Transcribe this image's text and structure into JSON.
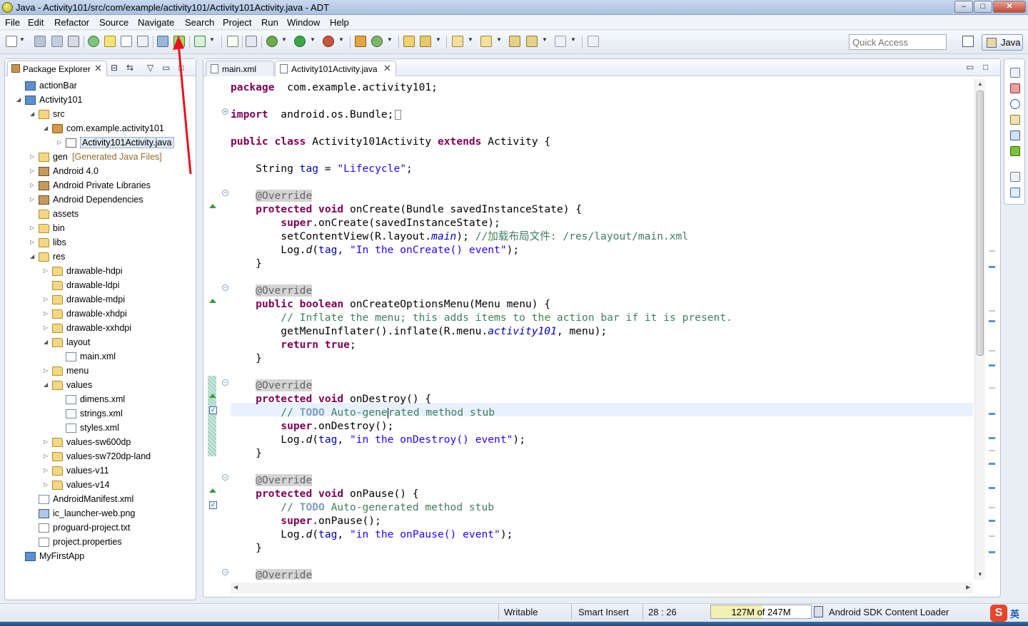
{
  "window": {
    "title": "Java - Activity101/src/com/example/activity101/Activity101Activity.java - ADT",
    "minimize": "–",
    "maximize": "□",
    "close": "✕"
  },
  "menu": [
    "File",
    "Edit",
    "Refactor",
    "Source",
    "Navigate",
    "Search",
    "Project",
    "Run",
    "Window",
    "Help"
  ],
  "toolbar": {
    "quick_access_placeholder": "Quick Access",
    "perspective_label": "Java"
  },
  "package_explorer": {
    "tab_label": "Package Explorer",
    "tree": [
      {
        "label": "actionBar",
        "depth": 0,
        "arrow": "",
        "icon": "project"
      },
      {
        "label": "Activity101",
        "depth": 0,
        "arrow": "open",
        "icon": "project"
      },
      {
        "label": "src",
        "depth": 1,
        "arrow": "open",
        "icon": "src"
      },
      {
        "label": "com.example.activity101",
        "depth": 2,
        "arrow": "open",
        "icon": "package"
      },
      {
        "label": "Activity101Activity.java",
        "depth": 3,
        "arrow": "closed",
        "icon": "java",
        "selected": true
      },
      {
        "label": "gen",
        "suffix": "[Generated Java Files]",
        "depth": 1,
        "arrow": "closed",
        "icon": "src"
      },
      {
        "label": "Android 4.0",
        "depth": 1,
        "arrow": "closed",
        "icon": "lib"
      },
      {
        "label": "Android Private Libraries",
        "depth": 1,
        "arrow": "closed",
        "icon": "lib"
      },
      {
        "label": "Android Dependencies",
        "depth": 1,
        "arrow": "closed",
        "icon": "lib"
      },
      {
        "label": "assets",
        "depth": 1,
        "arrow": "",
        "icon": "folder"
      },
      {
        "label": "bin",
        "depth": 1,
        "arrow": "closed",
        "icon": "folder"
      },
      {
        "label": "libs",
        "depth": 1,
        "arrow": "closed",
        "icon": "folder"
      },
      {
        "label": "res",
        "depth": 1,
        "arrow": "open",
        "icon": "folder"
      },
      {
        "label": "drawable-hdpi",
        "depth": 2,
        "arrow": "closed",
        "icon": "folder"
      },
      {
        "label": "drawable-ldpi",
        "depth": 2,
        "arrow": "",
        "icon": "folder"
      },
      {
        "label": "drawable-mdpi",
        "depth": 2,
        "arrow": "closed",
        "icon": "folder"
      },
      {
        "label": "drawable-xhdpi",
        "depth": 2,
        "arrow": "closed",
        "icon": "folder"
      },
      {
        "label": "drawable-xxhdpi",
        "depth": 2,
        "arrow": "closed",
        "icon": "folder"
      },
      {
        "label": "layout",
        "depth": 2,
        "arrow": "open",
        "icon": "folder"
      },
      {
        "label": "main.xml",
        "depth": 3,
        "arrow": "",
        "icon": "xml"
      },
      {
        "label": "menu",
        "depth": 2,
        "arrow": "closed",
        "icon": "folder"
      },
      {
        "label": "values",
        "depth": 2,
        "arrow": "open",
        "icon": "folder"
      },
      {
        "label": "dimens.xml",
        "depth": 3,
        "arrow": "",
        "icon": "xml"
      },
      {
        "label": "strings.xml",
        "depth": 3,
        "arrow": "",
        "icon": "xml"
      },
      {
        "label": "styles.xml",
        "depth": 3,
        "arrow": "",
        "icon": "xml"
      },
      {
        "label": "values-sw600dp",
        "depth": 2,
        "arrow": "closed",
        "icon": "folder"
      },
      {
        "label": "values-sw720dp-land",
        "depth": 2,
        "arrow": "closed",
        "icon": "folder"
      },
      {
        "label": "values-v11",
        "depth": 2,
        "arrow": "closed",
        "icon": "folder"
      },
      {
        "label": "values-v14",
        "depth": 2,
        "arrow": "closed",
        "icon": "folder"
      },
      {
        "label": "AndroidManifest.xml",
        "depth": 1,
        "arrow": "",
        "icon": "xml"
      },
      {
        "label": "ic_launcher-web.png",
        "depth": 1,
        "arrow": "",
        "icon": "png"
      },
      {
        "label": "proguard-project.txt",
        "depth": 1,
        "arrow": "",
        "icon": "file"
      },
      {
        "label": "project.properties",
        "depth": 1,
        "arrow": "",
        "icon": "file"
      },
      {
        "label": "MyFirstApp",
        "depth": 0,
        "arrow": "",
        "icon": "project"
      }
    ]
  },
  "editor": {
    "tabs": [
      {
        "label": "main.xml",
        "active": false
      },
      {
        "label": "Activity101Activity.java",
        "active": true
      }
    ],
    "current_line": 25,
    "code_lines": [
      [
        [
          "kw",
          "package"
        ],
        [
          "",
          "  com.example.activity101;"
        ]
      ],
      [],
      [
        [
          "kw",
          "import"
        ],
        [
          "",
          "  android.os.Bundle;"
        ],
        [
          "box",
          ""
        ]
      ],
      [],
      [
        [
          "kw",
          "public"
        ],
        [
          "",
          " "
        ],
        [
          "kw",
          "class"
        ],
        [
          "",
          " Activity101Activity "
        ],
        [
          "kw",
          "extends"
        ],
        [
          "",
          " Activity {"
        ]
      ],
      [],
      [
        [
          "",
          "    String "
        ],
        [
          "field",
          "tag"
        ],
        [
          "",
          " = "
        ],
        [
          "str",
          "\"Lifecycle\""
        ],
        [
          "",
          ";"
        ]
      ],
      [],
      [
        [
          "",
          "    "
        ],
        [
          "annot",
          "@Override"
        ]
      ],
      [
        [
          "",
          "    "
        ],
        [
          "kw",
          "protected"
        ],
        [
          "",
          " "
        ],
        [
          "kw",
          "void"
        ],
        [
          "",
          " onCreate(Bundle savedInstanceState) {"
        ]
      ],
      [
        [
          "",
          "        "
        ],
        [
          "kw",
          "super"
        ],
        [
          "",
          ".onCreate(savedInstanceState);"
        ]
      ],
      [
        [
          "",
          "        setContentView(R.layout."
        ],
        [
          "field ital",
          "main"
        ],
        [
          "",
          "); "
        ],
        [
          "cmt",
          "//加载布局文件: /res/layout/main.xml"
        ]
      ],
      [
        [
          "",
          "        Log."
        ],
        [
          "ital",
          "d"
        ],
        [
          "",
          "("
        ],
        [
          "field",
          "tag"
        ],
        [
          "",
          ", "
        ],
        [
          "str",
          "\"In the onCreate() event\""
        ],
        [
          "",
          ");"
        ]
      ],
      [
        [
          "",
          "    }"
        ]
      ],
      [],
      [
        [
          "",
          "    "
        ],
        [
          "annot",
          "@Override"
        ]
      ],
      [
        [
          "",
          "    "
        ],
        [
          "kw",
          "public"
        ],
        [
          "",
          " "
        ],
        [
          "kw",
          "boolean"
        ],
        [
          "",
          " onCreateOptionsMenu(Menu menu) {"
        ]
      ],
      [
        [
          "",
          "        "
        ],
        [
          "cmt",
          "// Inflate the menu; this adds items to the action bar if it is present."
        ]
      ],
      [
        [
          "",
          "        getMenuInflater().inflate(R.menu."
        ],
        [
          "field ital",
          "activity101"
        ],
        [
          "",
          ", menu);"
        ]
      ],
      [
        [
          "",
          "        "
        ],
        [
          "kw",
          "return"
        ],
        [
          "",
          " "
        ],
        [
          "kw",
          "true"
        ],
        [
          "",
          ";"
        ]
      ],
      [
        [
          "",
          "    }"
        ]
      ],
      [],
      [
        [
          "",
          "    "
        ],
        [
          "annot",
          "@Override"
        ]
      ],
      [
        [
          "",
          "    "
        ],
        [
          "kw",
          "protected"
        ],
        [
          "",
          " "
        ],
        [
          "kw",
          "void"
        ],
        [
          "",
          " onDestroy() {"
        ]
      ],
      [
        [
          "",
          "        "
        ],
        [
          "cmt",
          "// "
        ],
        [
          "todo",
          "TODO"
        ],
        [
          "cmt",
          " Auto-gene"
        ],
        [
          "caret",
          ""
        ],
        [
          "cmt",
          "rated method stub"
        ]
      ],
      [
        [
          "",
          "        "
        ],
        [
          "kw",
          "super"
        ],
        [
          "",
          ".onDestroy();"
        ]
      ],
      [
        [
          "",
          "        Log."
        ],
        [
          "ital",
          "d"
        ],
        [
          "",
          "("
        ],
        [
          "field",
          "tag"
        ],
        [
          "",
          ", "
        ],
        [
          "str",
          "\"in the onDestroy() event\""
        ],
        [
          "",
          ");"
        ]
      ],
      [
        [
          "",
          "    }"
        ]
      ],
      [],
      [
        [
          "",
          "    "
        ],
        [
          "annot",
          "@Override"
        ]
      ],
      [
        [
          "",
          "    "
        ],
        [
          "kw",
          "protected"
        ],
        [
          "",
          " "
        ],
        [
          "kw",
          "void"
        ],
        [
          "",
          " onPause() {"
        ]
      ],
      [
        [
          "",
          "        "
        ],
        [
          "cmt",
          "// "
        ],
        [
          "todo",
          "TODO"
        ],
        [
          "cmt",
          " Auto-generated method stub"
        ]
      ],
      [
        [
          "",
          "        "
        ],
        [
          "kw",
          "super"
        ],
        [
          "",
          ".onPause();"
        ]
      ],
      [
        [
          "",
          "        Log."
        ],
        [
          "ital",
          "d"
        ],
        [
          "",
          "("
        ],
        [
          "field",
          "tag"
        ],
        [
          "",
          ", "
        ],
        [
          "str",
          "\"in the onPause() event\""
        ],
        [
          "",
          ");"
        ]
      ],
      [
        [
          "",
          "    }"
        ]
      ],
      [],
      [
        [
          "",
          "    "
        ],
        [
          "annot",
          "@Override"
        ]
      ]
    ]
  },
  "status": {
    "writable": "Writable",
    "insert_mode": "Smart Insert",
    "position": "28 : 26",
    "heap": "127M of 247M",
    "heap_used_fraction": 0.514,
    "loader": "Android SDK Content Loader",
    "ime_lang": "英",
    "ime_logo": "S"
  },
  "colors": {
    "keyword": "#7f0055",
    "string": "#2a00ff",
    "comment": "#3f7f5f",
    "field": "#0000c0",
    "annotation_arrow": "#e8121b"
  }
}
